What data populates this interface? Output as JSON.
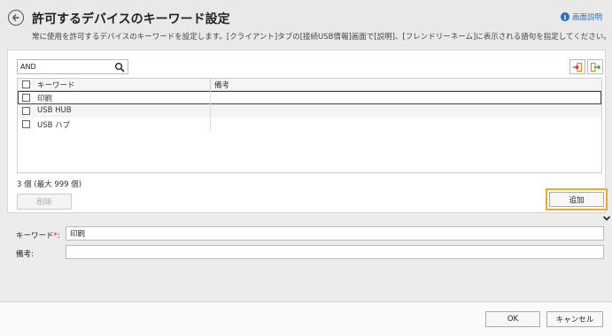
{
  "header": {
    "title": "許可するデバイスのキーワード設定",
    "description": "常に使用を許可するデバイスのキーワードを設定します。[クライアント]タブの[接続USB情報]画面で[説明]、[フレンドリーネーム]に表示される語句を指定してください。",
    "help_label": "画面説明",
    "help_glyph": "i"
  },
  "search": {
    "value": "AND"
  },
  "grid": {
    "columns": [
      "キーワード",
      "備考"
    ],
    "rows": [
      {
        "keyword": "印刷",
        "note": ""
      },
      {
        "keyword": "USB HUB",
        "note": ""
      },
      {
        "keyword": "USB ハブ",
        "note": ""
      }
    ]
  },
  "count_text": "3 個 (最大 999 個)",
  "buttons": {
    "delete": "削除",
    "add": "追加",
    "ok": "OK",
    "cancel": "キャンセル"
  },
  "form": {
    "keyword_label": "キーワード",
    "required_mark": "*",
    "keyword_colon": ":",
    "keyword_value": "印刷",
    "note_label": "備考:",
    "note_value": ""
  },
  "icons": {
    "back": "back-arrow-icon",
    "help": "info-icon",
    "search": "search-icon",
    "import": "import-icon",
    "export": "export-icon",
    "collapse": "chevron-down-icon"
  },
  "colors": {
    "accent_orange": "#f0a726",
    "link_blue": "#2a6fbf",
    "required_red": "#d9222a"
  }
}
